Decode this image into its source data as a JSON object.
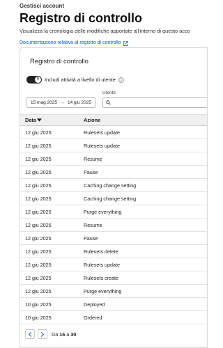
{
  "header": {
    "breadcrumb": "Gestisci account",
    "title": "Registro di controllo",
    "description": "Visualizza la cronologia delle modifiche apportate all'interno di questo acco",
    "doc_link": "Documentazione relativa al registro di controllo"
  },
  "card": {
    "title": "Registro di controllo",
    "toggle_label": "Includi attività a livello di utente",
    "toggle_on": false,
    "date_from": "15 mag 2025",
    "date_arrow": "→",
    "date_to": "14 giu 2025",
    "user_label": "Utente",
    "user_value": "",
    "user_placeholder": ""
  },
  "table": {
    "columns": {
      "date": "Data",
      "action": "Azione"
    },
    "rows": [
      {
        "date": "12 giu 2025",
        "action": "Rulesets update"
      },
      {
        "date": "12 giu 2025",
        "action": "Rulesets update"
      },
      {
        "date": "12 giu 2025",
        "action": "Resume"
      },
      {
        "date": "12 giu 2025",
        "action": "Pause"
      },
      {
        "date": "12 giu 2025",
        "action": "Caching change setting"
      },
      {
        "date": "12 giu 2025",
        "action": "Caching change setting"
      },
      {
        "date": "12 giu 2025",
        "action": "Purge everything"
      },
      {
        "date": "12 giu 2025",
        "action": "Resume"
      },
      {
        "date": "12 giu 2025",
        "action": "Pause"
      },
      {
        "date": "12 giu 2025",
        "action": "Rulesets delete"
      },
      {
        "date": "12 giu 2025",
        "action": "Rulesets update"
      },
      {
        "date": "12 giu 2025",
        "action": "Rulesets create"
      },
      {
        "date": "12 giu 2025",
        "action": "Purge everything"
      },
      {
        "date": "10 giu 2025",
        "action": "Deployed"
      },
      {
        "date": "10 giu 2025",
        "action": "Ordered"
      }
    ]
  },
  "pagination": {
    "prefix": "Da",
    "from": "16",
    "separator": "a",
    "to": "30"
  },
  "colors": {
    "link": "#0b57d0",
    "toggle_off": "#222222",
    "header_bg": "#f0f0f0"
  },
  "icons": {
    "doc_link": "external-link-icon",
    "info": "info-icon",
    "search": "search-icon",
    "sort": "sort-down-icon",
    "prev": "chevron-left-icon",
    "next": "chevron-right-icon"
  }
}
